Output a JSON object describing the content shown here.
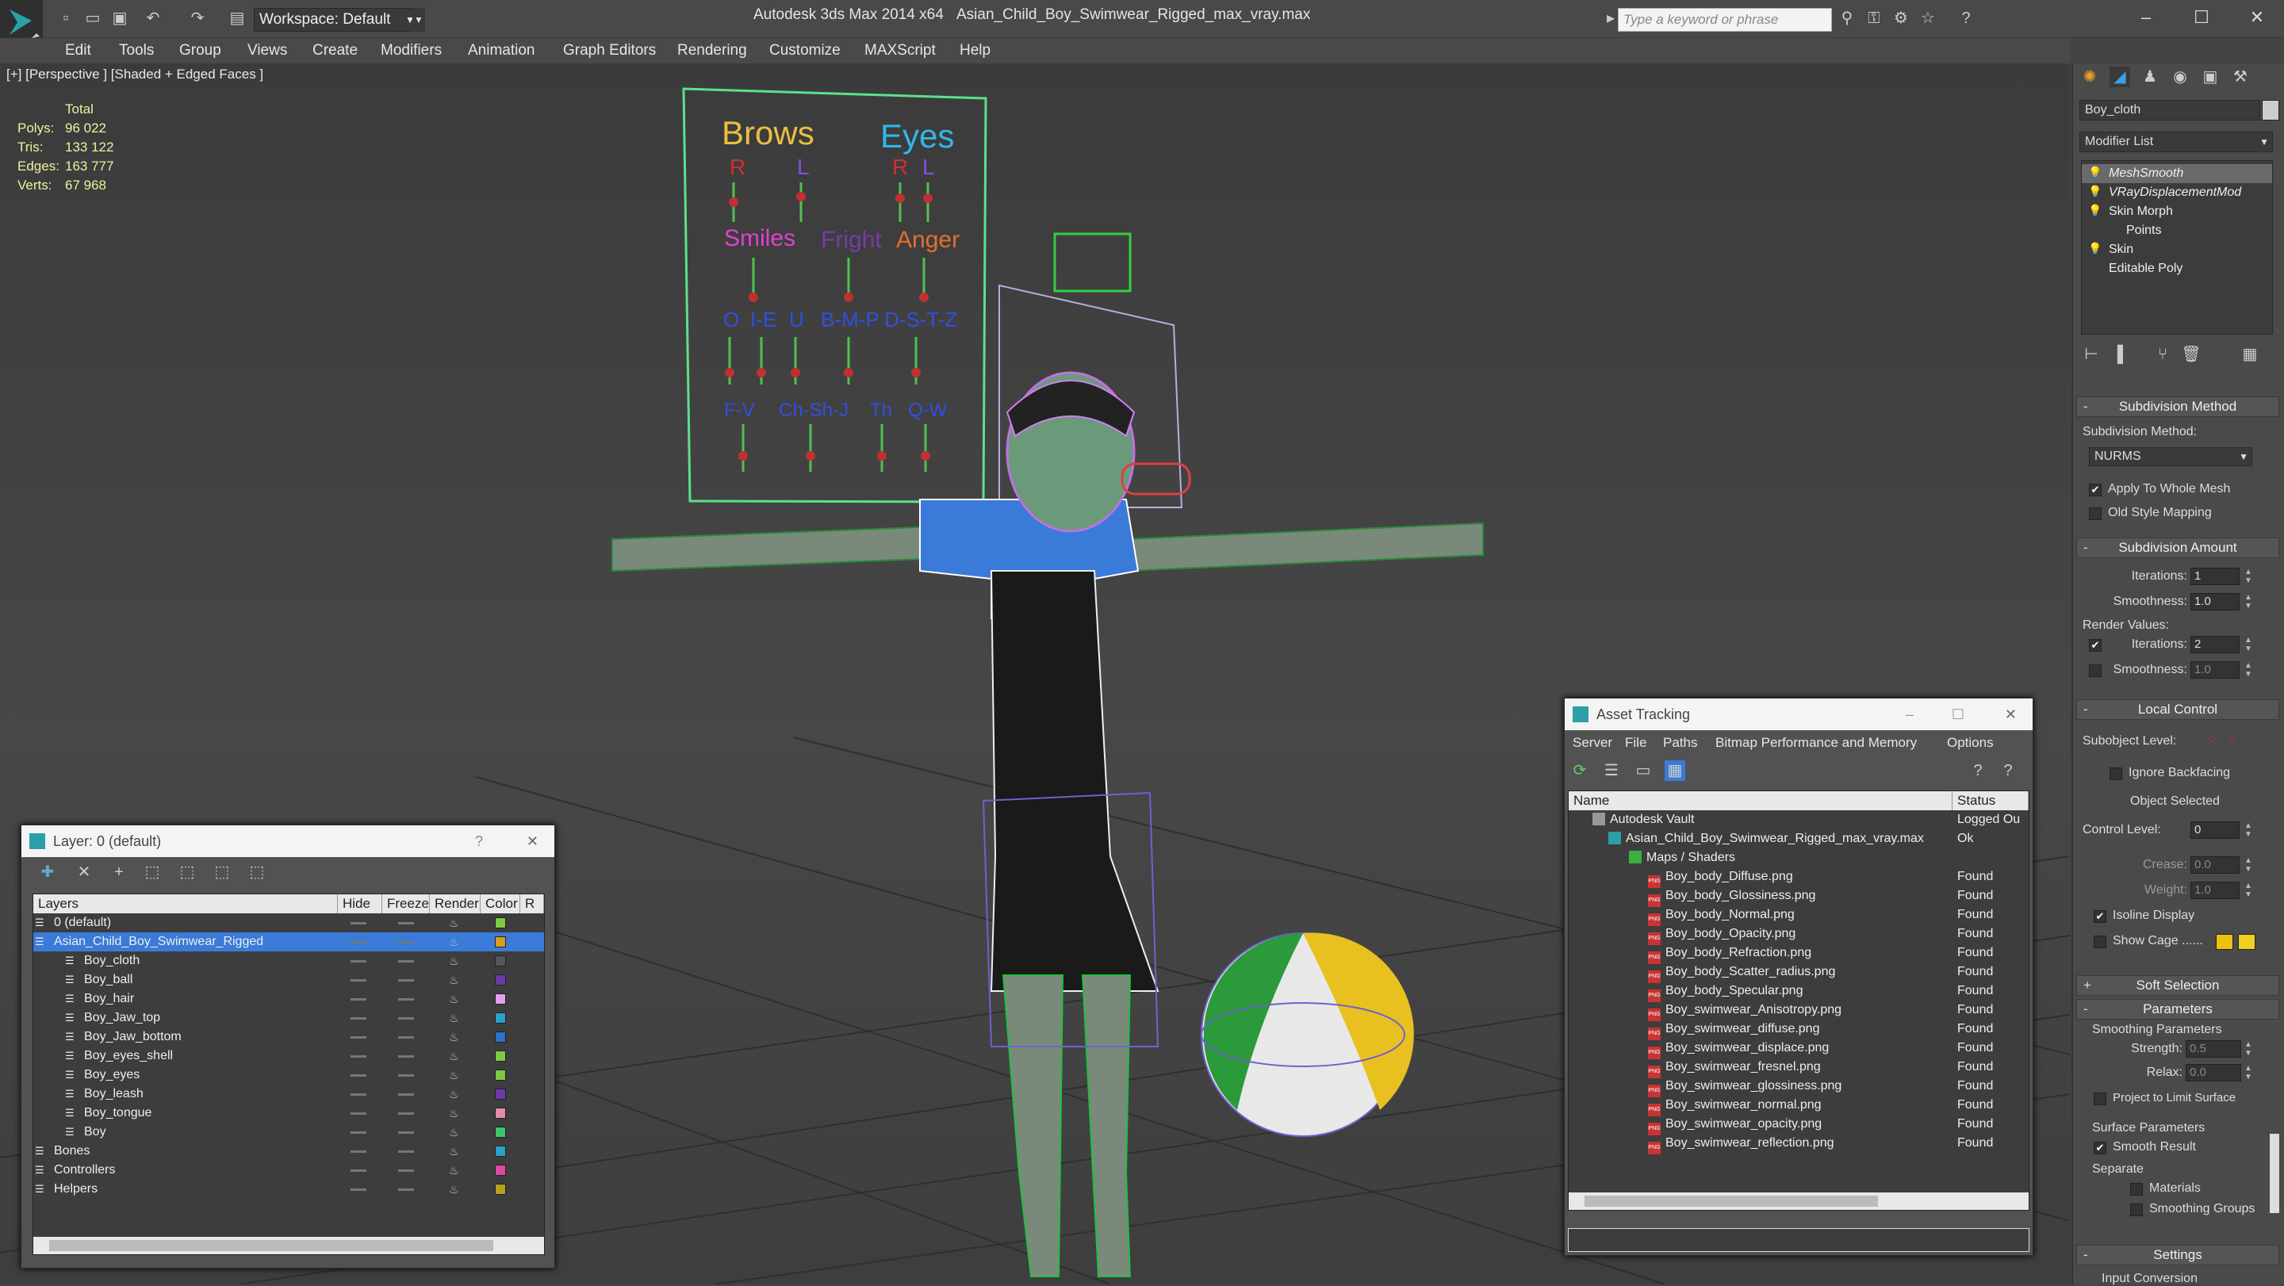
{
  "titlebar": {
    "app_title": "Autodesk 3ds Max  2014 x64",
    "file_title": "Asian_Child_Boy_Swimwear_Rigged_max_vray.max",
    "workspace": "Workspace: Default",
    "search_placeholder": "Type a keyword or phrase"
  },
  "menu": [
    "Edit",
    "Tools",
    "Group",
    "Views",
    "Create",
    "Modifiers",
    "Animation",
    "Graph Editors",
    "Rendering",
    "Customize",
    "MAXScript",
    "Help"
  ],
  "viewport": {
    "label": "[+] [Perspective ] [Shaded + Edged Faces ]",
    "stats_header": "Total",
    "stats": [
      {
        "label": "Polys:",
        "value": "96 022"
      },
      {
        "label": "Tris:",
        "value": "133 122"
      },
      {
        "label": "Edges:",
        "value": "163 777"
      },
      {
        "label": "Verts:",
        "value": "67 968"
      }
    ],
    "face_rig": {
      "brows": "Brows",
      "eyes": "Eyes",
      "r": "R",
      "l": "L",
      "smiles": "Smiles",
      "fright": "Fright",
      "anger": "Anger",
      "row3": [
        "O",
        "I-E",
        "U",
        "B-M-P",
        "D-S-T-Z"
      ],
      "row4": [
        "F-V",
        "Ch-Sh-J",
        "Th",
        "Q-W"
      ]
    }
  },
  "command_panel": {
    "object_name": "Boy_cloth",
    "modifier_list": "Modifier List",
    "modifiers": [
      "MeshSmooth",
      "VRayDisplacementMod",
      "Skin Morph",
      "Points",
      "Skin",
      "Editable Poly"
    ],
    "subdivision_method": {
      "rollout": "Subdivision Method",
      "label": "Subdivision Method:",
      "value": "NURMS",
      "apply_whole": "Apply To Whole Mesh",
      "old_style": "Old Style Mapping"
    },
    "subdivision_amount": {
      "rollout": "Subdivision Amount",
      "iterations": "Iterations:",
      "iterations_value": "1",
      "smoothness": "Smoothness:",
      "smoothness_value": "1.0",
      "render_values": "Render Values:",
      "r_iterations": "Iterations:",
      "r_iterations_value": "2",
      "r_smoothness": "Smoothness:",
      "r_smoothness_value": "1.0"
    },
    "local_control": {
      "rollout": "Local Control",
      "subobject": "Subobject Level:",
      "ignore_backfacing": "Ignore Backfacing",
      "object_selected": "Object Selected",
      "control_level": "Control Level:",
      "control_level_value": "0",
      "crease": "Crease:",
      "crease_value": "0.0",
      "weight": "Weight:",
      "weight_value": "1.0",
      "isoline": "Isoline Display",
      "show_cage": "Show Cage ......"
    },
    "soft_selection": "Soft Selection",
    "parameters": {
      "rollout": "Parameters",
      "smoothing": "Smoothing Parameters",
      "strength": "Strength:",
      "strength_value": "0.5",
      "relax": "Relax:",
      "relax_value": "0.0",
      "project": "Project to Limit Surface",
      "surface": "Surface Parameters",
      "smooth_result": "Smooth Result",
      "separate": "Separate",
      "materials": "Materials",
      "smoothing_groups": "Smoothing Groups"
    },
    "settings": "Settings",
    "input_conversion": "Input Conversion"
  },
  "layer_panel": {
    "title": "Layer: 0 (default)",
    "columns": [
      "Layers",
      "Hide",
      "Freeze",
      "Render",
      "Color",
      "R"
    ],
    "rows": [
      {
        "name": "0 (default)",
        "color": "#7ec843"
      },
      {
        "name": "Asian_Child_Boy_Swimwear_Rigged",
        "color": "#d3a020"
      },
      {
        "name": "Boy_cloth",
        "color": "#555555"
      },
      {
        "name": "Boy_ball",
        "color": "#6a3aa8"
      },
      {
        "name": "Boy_hair",
        "color": "#e4a0e8"
      },
      {
        "name": "Boy_Jaw_top",
        "color": "#2aa2c8"
      },
      {
        "name": "Boy_Jaw_bottom",
        "color": "#2a72c8"
      },
      {
        "name": "Boy_eyes_shell",
        "color": "#7ec843"
      },
      {
        "name": "Boy_eyes",
        "color": "#7ec843"
      },
      {
        "name": "Boy_leash",
        "color": "#6a3aa8"
      },
      {
        "name": "Boy_tongue",
        "color": "#e48aa8"
      },
      {
        "name": "Boy",
        "color": "#3ac86a"
      },
      {
        "name": "Bones",
        "color": "#2aa2c8"
      },
      {
        "name": "Controllers",
        "color": "#e048a8"
      },
      {
        "name": "Helpers",
        "color": "#b8a020"
      }
    ]
  },
  "asset_tracking": {
    "title": "Asset Tracking",
    "menu": [
      "Server",
      "File",
      "Paths",
      "Bitmap Performance and Memory",
      "Options"
    ],
    "columns": [
      "Name",
      "Status"
    ],
    "rows": [
      {
        "name": "Autodesk Vault",
        "status": "Logged Ou"
      },
      {
        "name": "Asian_Child_Boy_Swimwear_Rigged_max_vray.max",
        "status": "Ok"
      },
      {
        "name": "Maps / Shaders",
        "status": ""
      },
      {
        "name": "Boy_body_Diffuse.png",
        "status": "Found"
      },
      {
        "name": "Boy_body_Glossiness.png",
        "status": "Found"
      },
      {
        "name": "Boy_body_Normal.png",
        "status": "Found"
      },
      {
        "name": "Boy_body_Opacity.png",
        "status": "Found"
      },
      {
        "name": "Boy_body_Refraction.png",
        "status": "Found"
      },
      {
        "name": "Boy_body_Scatter_radius.png",
        "status": "Found"
      },
      {
        "name": "Boy_body_Specular.png",
        "status": "Found"
      },
      {
        "name": "Boy_swimwear_Anisotropy.png",
        "status": "Found"
      },
      {
        "name": "Boy_swimwear_diffuse.png",
        "status": "Found"
      },
      {
        "name": "Boy_swimwear_displace.png",
        "status": "Found"
      },
      {
        "name": "Boy_swimwear_fresnel.png",
        "status": "Found"
      },
      {
        "name": "Boy_swimwear_glossiness.png",
        "status": "Found"
      },
      {
        "name": "Boy_swimwear_normal.png",
        "status": "Found"
      },
      {
        "name": "Boy_swimwear_opacity.png",
        "status": "Found"
      },
      {
        "name": "Boy_swimwear_reflection.png",
        "status": "Found"
      }
    ]
  }
}
